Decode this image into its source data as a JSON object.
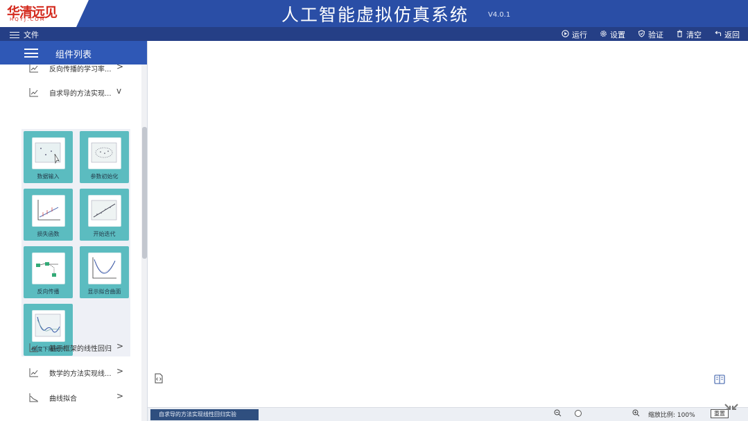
{
  "logo": {
    "text": "华清远见",
    "sub": "HQYJ.COM",
    "color": "#d42a1e"
  },
  "header": {
    "title": "人工智能虚拟仿真系统",
    "version": "V4.0.1"
  },
  "menu": {
    "file_label": "文件"
  },
  "toolbar": {
    "run": "运行",
    "settings": "设置",
    "verify": "验证",
    "clear": "清空",
    "back": "返回",
    "icons": [
      "play-circle-icon",
      "gear-icon",
      "shield-icon",
      "trash-icon",
      "return-icon"
    ]
  },
  "sidebar": {
    "title": "组件列表",
    "categories": [
      {
        "label": "反向传播的学习率...",
        "chevron": ">"
      },
      {
        "label": "自求导的方法实现...",
        "chevron": "v"
      },
      {
        "label": "基于框架的线性回归",
        "chevron": ">"
      },
      {
        "label": "数学的方法实现线...",
        "chevron": ">"
      },
      {
        "label": "曲线拟合",
        "chevron": ">"
      }
    ],
    "cards": [
      {
        "label": "数据输入"
      },
      {
        "label": "参数初始化"
      },
      {
        "label": "损失函数"
      },
      {
        "label": "开始迭代"
      },
      {
        "label": "反向传播"
      },
      {
        "label": "显示拟合曲面"
      },
      {
        "label": "梯度下降展示"
      }
    ]
  },
  "status": {
    "tab_text": "自求导的方法实现线性回归实验",
    "zoom_label": "缩放比例: 100%",
    "reset_label": "重置"
  },
  "colors": {
    "title_bar": "#2a4ea6",
    "menu_bar": "#253f86",
    "sidebar_header": "#2f58b6",
    "card": "#5bbcc0"
  }
}
